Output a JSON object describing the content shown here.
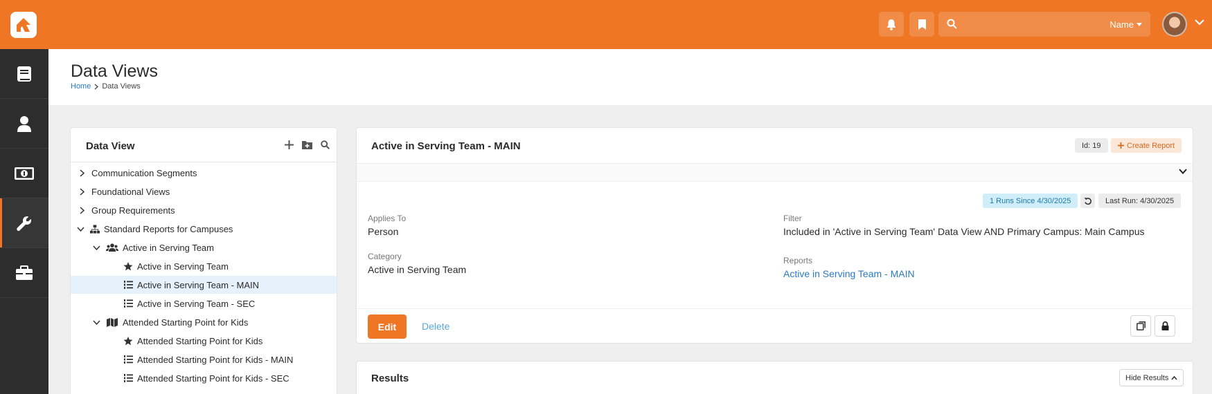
{
  "colors": {
    "brand": "#ee7625",
    "sidebar": "#2d2d2d",
    "link": "#2a7ac2",
    "info": "#cfeefa"
  },
  "topbar": {
    "logo_icon": "rock-logo-icon",
    "notifications_icon": "bell-icon",
    "bookmarks_icon": "bookmark-icon",
    "search_placeholder": "",
    "search_scope": "Name",
    "avatar_icon": "user-avatar"
  },
  "sidebar": {
    "items": [
      {
        "icon": "book-icon"
      },
      {
        "icon": "person-icon"
      },
      {
        "icon": "money-icon"
      },
      {
        "icon": "wrench-icon",
        "active": true
      },
      {
        "icon": "briefcase-icon"
      }
    ]
  },
  "header": {
    "title": "Data Views",
    "breadcrumb": [
      "Home",
      "Data Views"
    ]
  },
  "tree": {
    "title": "Data View",
    "actions": [
      "plus-icon",
      "folder-plus-icon",
      "search-icon"
    ],
    "items": [
      {
        "label": "Communication Segments",
        "level": 0,
        "expander": "right"
      },
      {
        "label": "Foundational Views",
        "level": 0,
        "expander": "right"
      },
      {
        "label": "Group Requirements",
        "level": 0,
        "expander": "right"
      },
      {
        "label": "Standard Reports for Campuses",
        "level": 0,
        "expander": "down",
        "icon": "sitemap-icon"
      },
      {
        "label": "Active in Serving Team",
        "level": 1,
        "expander": "down",
        "icon": "users-icon"
      },
      {
        "label": "Active in Serving Team",
        "level": 2,
        "icon": "star-icon"
      },
      {
        "label": "Active in Serving Team - MAIN",
        "level": 2,
        "icon": "list-ol-icon",
        "selected": true
      },
      {
        "label": "Active in Serving Team - SEC",
        "level": 2,
        "icon": "list-ol-icon"
      },
      {
        "label": "Attended Starting Point for Kids",
        "level": 1,
        "expander": "down",
        "icon": "map-icon"
      },
      {
        "label": "Attended Starting Point for Kids",
        "level": 2,
        "icon": "star-icon"
      },
      {
        "label": "Attended Starting Point for Kids - MAIN",
        "level": 2,
        "icon": "list-ol-icon"
      },
      {
        "label": "Attended Starting Point for Kids - SEC",
        "level": 2,
        "icon": "list-ol-icon"
      }
    ]
  },
  "detail": {
    "title": "Active in Serving Team - MAIN",
    "id_label": "Id: 19",
    "create_report_label": "Create Report",
    "runs_label": "1 Runs Since 4/30/2025",
    "last_run_label": "Last Run: 4/30/2025",
    "applies_to_label": "Applies To",
    "applies_to_value": "Person",
    "category_label": "Category",
    "category_value": "Active in Serving Team",
    "filter_label": "Filter",
    "filter_value": "Included in 'Active in Serving Team' Data View AND Primary Campus: Main Campus",
    "reports_label": "Reports",
    "reports_value": "Active in Serving Team - MAIN",
    "edit_label": "Edit",
    "delete_label": "Delete"
  },
  "results": {
    "title": "Results",
    "hide_label": "Hide Results"
  }
}
